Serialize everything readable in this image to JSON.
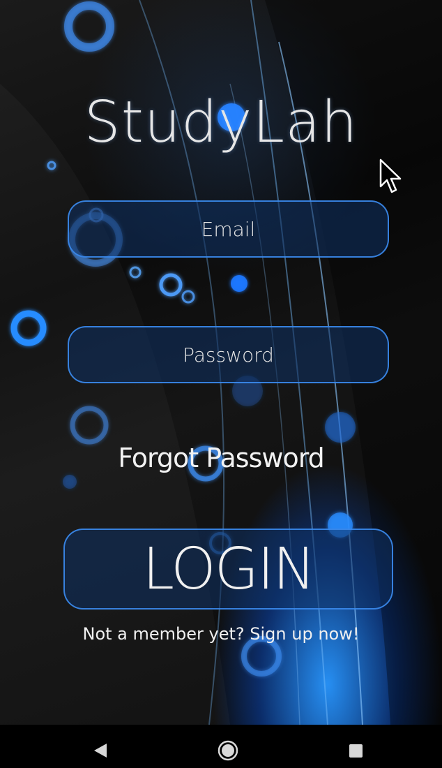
{
  "app": {
    "title": "StudyLah"
  },
  "login_form": {
    "email_placeholder": "Email",
    "password_placeholder": "Password",
    "forgot_password_label": "Forgot Password",
    "login_label": "LOGIN",
    "signup_label": "Not a member yet? Sign up now!"
  },
  "navbar": {
    "back_icon": "back-triangle-icon",
    "home_icon": "home-circle-icon",
    "recent_icon": "recent-square-icon"
  },
  "colors": {
    "accent_blue": "#2a8cff",
    "field_border": "#3c8cf0",
    "text": "#f0f0f0"
  }
}
